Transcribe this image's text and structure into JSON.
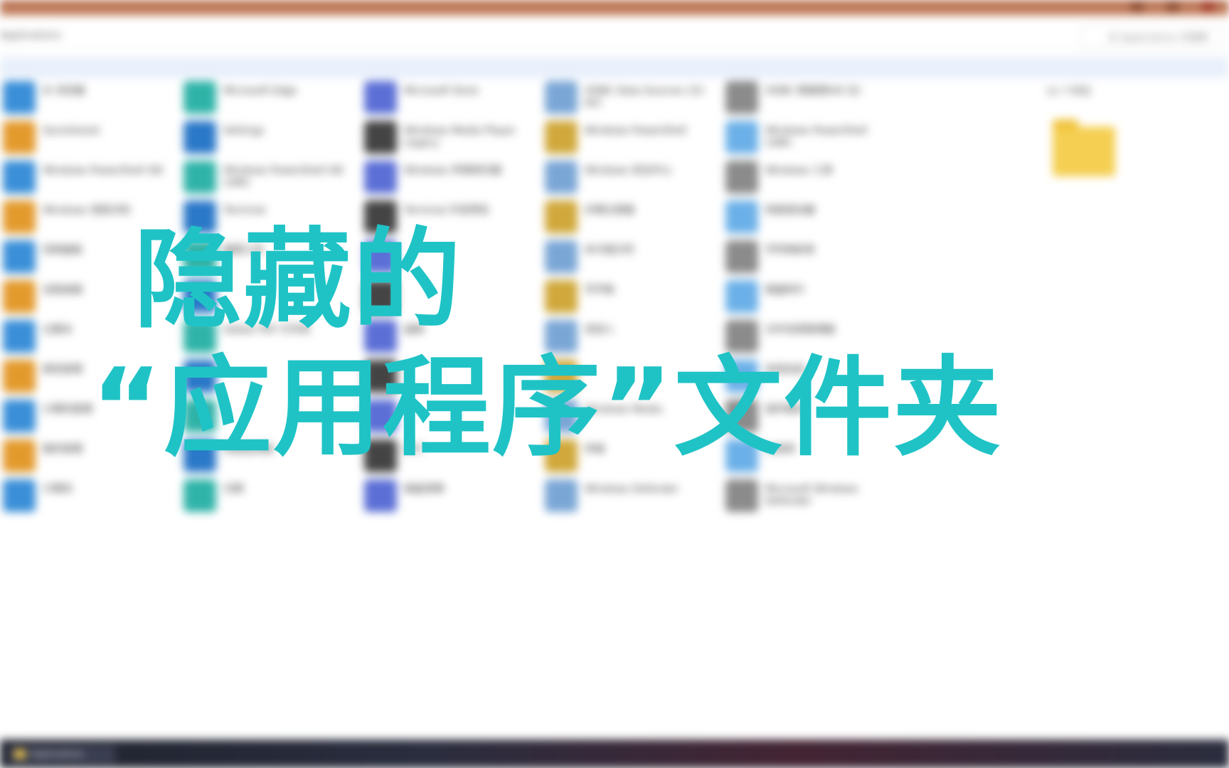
{
  "window": {
    "address": "Applications",
    "search_placeholder": "在 Applications 中搜索"
  },
  "preview": {
    "title": "14 个项目"
  },
  "overlay": {
    "line1": "隐藏的",
    "line2": "“应用程序”文件夹"
  },
  "items": [
    [
      "IE 浏览器",
      "Microsoft Edge",
      "Microsoft Store",
      "ODBC Data Sources (32-bit)",
      "ODBC 数据源(64 位)"
    ],
    [
      "QuickAssist",
      "Settings",
      "Windows Media Player Legacy",
      "Windows PowerShell",
      "Windows PowerShell (x86)"
    ],
    [
      "Windows PowerShell ISE",
      "Windows PowerShell ISE (x86)",
      "Windows 传真和扫描",
      "Windows 安全中心",
      "Windows 工具"
    ],
    [
      "Windows 语音识别",
      "Terminal",
      "Terminal 开发预览",
      "步骤记录器",
      "恢复驱动器"
    ],
    [
      "控制面板",
      "截图工具",
      "",
      "命令提示符",
      "字符映射表"
    ],
    [
      "远程桌面",
      "",
      "",
      "写字板",
      "磁盘碎片"
    ],
    [
      "记事本",
      "Adobe PDF 打印机",
      "画图",
      "讲述人",
      "文件资源管理器"
    ],
    [
      "颜色管理",
      "",
      "",
      "",
      "系统信息"
    ],
    [
      "计算机管理",
      "",
      "",
      "Windows Media",
      "组件服务"
    ],
    [
      "服务管理",
      "性能监视器",
      "运行",
      "终端",
      "注册表"
    ],
    [
      "计算机",
      "日期",
      "磁盘清理",
      "Windows Defender",
      "Microsoft Windows Defender"
    ]
  ],
  "taskbar": {
    "app_label": "Applications"
  },
  "colors": {
    "overlay_text": "#1fc3c6",
    "titlebar": "#b26848"
  }
}
